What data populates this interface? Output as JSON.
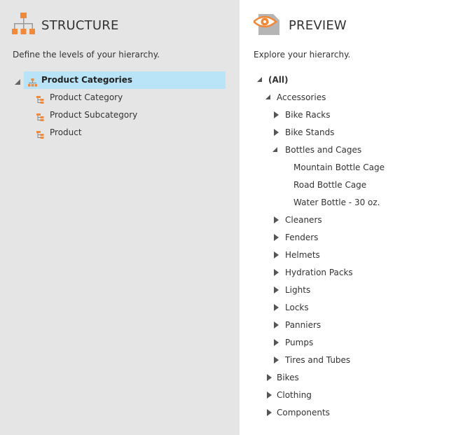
{
  "structure": {
    "title": "STRUCTURE",
    "subtitle": "Define the levels of your hierarchy.",
    "root_label": "Product Categories",
    "levels": [
      "Product Category",
      "Product Subcategory",
      "Product"
    ]
  },
  "preview": {
    "title": "PREVIEW",
    "subtitle": "Explore your hierarchy.",
    "nodes": [
      {
        "label": "(All)",
        "depth": 0,
        "state": "expanded",
        "bold": true
      },
      {
        "label": "Accessories",
        "depth": 1,
        "state": "expanded"
      },
      {
        "label": "Bike Racks",
        "depth": 2,
        "state": "collapsed"
      },
      {
        "label": "Bike Stands",
        "depth": 2,
        "state": "collapsed"
      },
      {
        "label": "Bottles and Cages",
        "depth": 2,
        "state": "expanded"
      },
      {
        "label": "Mountain Bottle Cage",
        "depth": 3,
        "state": "leaf"
      },
      {
        "label": "Road Bottle Cage",
        "depth": 3,
        "state": "leaf"
      },
      {
        "label": "Water Bottle - 30 oz.",
        "depth": 3,
        "state": "leaf"
      },
      {
        "label": "Cleaners",
        "depth": 2,
        "state": "collapsed"
      },
      {
        "label": "Fenders",
        "depth": 2,
        "state": "collapsed"
      },
      {
        "label": "Helmets",
        "depth": 2,
        "state": "collapsed"
      },
      {
        "label": "Hydration Packs",
        "depth": 2,
        "state": "collapsed"
      },
      {
        "label": "Lights",
        "depth": 2,
        "state": "collapsed"
      },
      {
        "label": "Locks",
        "depth": 2,
        "state": "collapsed"
      },
      {
        "label": "Panniers",
        "depth": 2,
        "state": "collapsed"
      },
      {
        "label": "Pumps",
        "depth": 2,
        "state": "collapsed"
      },
      {
        "label": "Tires and Tubes",
        "depth": 2,
        "state": "collapsed"
      },
      {
        "label": "Bikes",
        "depth": 1,
        "state": "collapsed"
      },
      {
        "label": "Clothing",
        "depth": 1,
        "state": "collapsed"
      },
      {
        "label": "Components",
        "depth": 1,
        "state": "collapsed"
      }
    ]
  },
  "colors": {
    "accent": "#f0893a",
    "selection": "#b9e4f7",
    "left_panel_bg": "#e5e5e5"
  },
  "icons": {
    "structure": "hierarchy-icon",
    "preview": "eye-icon",
    "level": "hierarchy-level-icon"
  }
}
